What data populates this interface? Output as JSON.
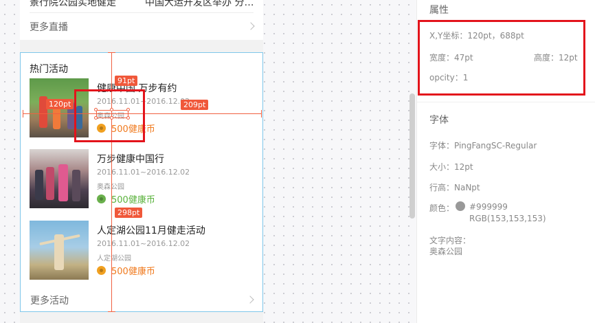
{
  "phone": {
    "previous_item": {
      "title_fragment": "景行院公园实地健走",
      "right_fragment": "中国大运开发区举办 分…"
    },
    "more_live_label": "更多直播",
    "section_title": "热门活动",
    "items": [
      {
        "title": "健康中国 万步有约",
        "date": "2016.11.01~2016.12.02",
        "place": "奥森公园",
        "reward": "500健康币",
        "reward_color": "#f07a1e",
        "coin_color": "#f0a020"
      },
      {
        "title": "万步健康中国行",
        "date": "2016.11.01~2016.12.02",
        "place": "奥森公园",
        "reward": "500健康币",
        "reward_color": "#5ab23c",
        "coin_color": "#6ab04c"
      },
      {
        "title": "人定湖公园11月健走活动",
        "date": "2016.11.01~2016.12.02",
        "place": "人定湖公园",
        "reward": "500健康币",
        "reward_color": "#f07a1e",
        "coin_color": "#f0a020"
      }
    ],
    "more_activities_label": "更多活动"
  },
  "measurements": {
    "top": "91pt",
    "left": "120pt",
    "right": "209pt",
    "bottom": "298pt"
  },
  "panel": {
    "properties_title": "属性",
    "coords": "X,Y坐标：120pt，688pt",
    "width": "宽度：47pt",
    "height": "高度：12pt",
    "opacity": "opcity：1",
    "font_title": "字体",
    "font_family": "字体：PingFangSC-Regular",
    "font_size": "大小：12pt",
    "line_height": "行高：NaNpt",
    "color_label": "颜色：",
    "color_hex": "#999999",
    "color_rgb": "RGB(153,153,153)",
    "text_content_label": "文字内容：",
    "text_content": "奥森公园",
    "swatch_color": "#999999"
  },
  "colors": {
    "accent_measure": "#f0583a",
    "highlight_box": "#e3131b"
  }
}
